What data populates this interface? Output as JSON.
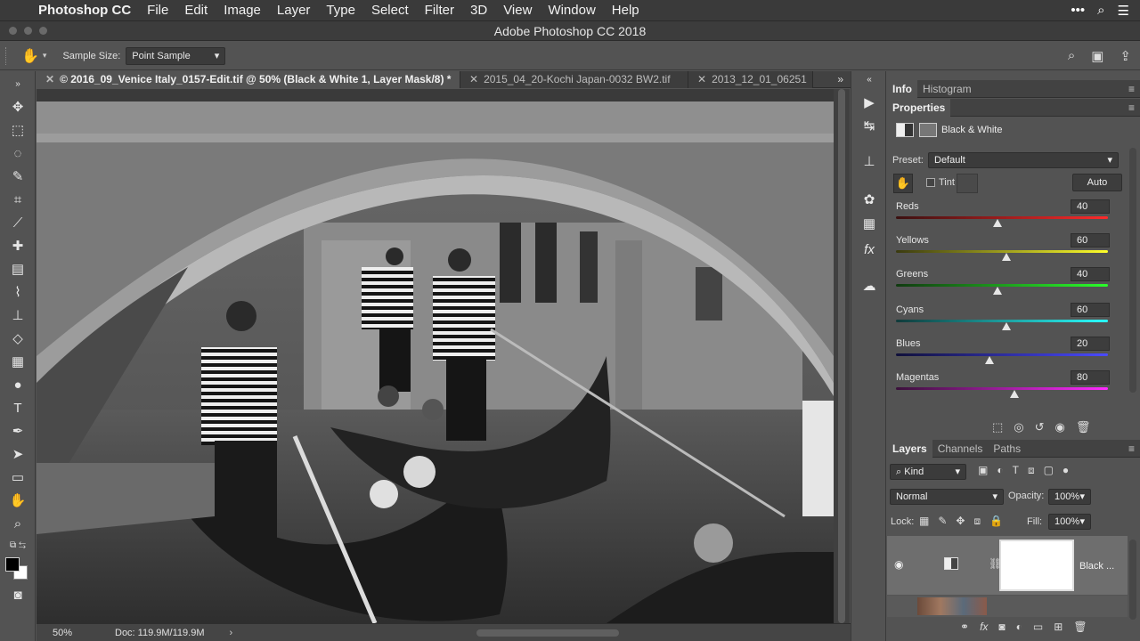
{
  "menubar": {
    "app": "Photoshop CC",
    "items": [
      "File",
      "Edit",
      "Image",
      "Layer",
      "Type",
      "Select",
      "Filter",
      "3D",
      "View",
      "Window",
      "Help"
    ]
  },
  "titlebar": {
    "title": "Adobe Photoshop CC 2018"
  },
  "options": {
    "sample_size_label": "Sample Size:",
    "sample_size_value": "Point Sample"
  },
  "tabs": [
    {
      "label": "© 2016_09_Venice Italy_0157-Edit.tif @ 50% (Black & White 1, Layer Mask/8) *"
    },
    {
      "label": "2015_04_20-Kochi Japan-0032 BW2.tif"
    },
    {
      "label": "2013_12_01_06251"
    }
  ],
  "more_tabs": "»",
  "status": {
    "zoom": "50%",
    "doc": "Doc: 119.9M/119.9M"
  },
  "panels": {
    "top_tabs": [
      "Info",
      "Histogram"
    ],
    "properties_title": "Properties",
    "adjustment_name": "Black & White",
    "preset_label": "Preset:",
    "preset_value": "Default",
    "tint_label": "Tint",
    "auto_label": "Auto",
    "sliders": [
      {
        "name": "Reds",
        "value": 40,
        "colors": [
          "#3a1010",
          "#ff2a2a"
        ]
      },
      {
        "name": "Yellows",
        "value": 60,
        "colors": [
          "#3a3a10",
          "#ffff2a"
        ]
      },
      {
        "name": "Greens",
        "value": 40,
        "colors": [
          "#103a10",
          "#2aff2a"
        ]
      },
      {
        "name": "Cyans",
        "value": 60,
        "colors": [
          "#103a3a",
          "#2affff"
        ]
      },
      {
        "name": "Blues",
        "value": 20,
        "colors": [
          "#10103a",
          "#4a4aff"
        ]
      },
      {
        "name": "Magentas",
        "value": 80,
        "colors": [
          "#3a103a",
          "#ff2aff"
        ]
      }
    ],
    "layer_tabs": [
      "Layers",
      "Channels",
      "Paths"
    ],
    "kind_label": "Kind",
    "blend_mode": "Normal",
    "opacity_label": "Opacity:",
    "opacity_value": "100%",
    "lock_label": "Lock:",
    "fill_label": "Fill:",
    "fill_value": "100%",
    "layer_name": "Black ..."
  }
}
